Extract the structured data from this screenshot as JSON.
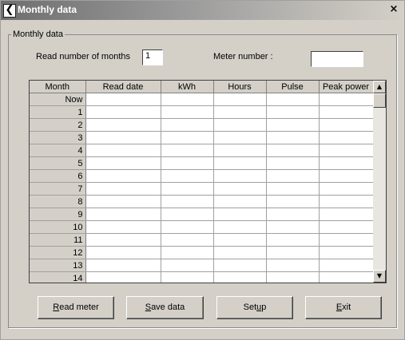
{
  "window": {
    "title": "Monthly data",
    "close_glyph": "×",
    "app_icon_glyph": "❮"
  },
  "group": {
    "legend": "Monthly data"
  },
  "fields": {
    "months_label": "Read number of months",
    "months_value": "1",
    "meter_label": "Meter number :",
    "meter_value": ""
  },
  "table": {
    "columns": [
      "Month",
      "Read date",
      "kWh",
      "Hours",
      "Pulse",
      "Peak power"
    ],
    "rows": [
      "Now",
      "1",
      "2",
      "3",
      "4",
      "5",
      "6",
      "7",
      "8",
      "9",
      "10",
      "11",
      "12",
      "13",
      "14"
    ]
  },
  "scrollbar": {
    "up_glyph": "▲",
    "down_glyph": "▼"
  },
  "buttons": [
    {
      "key": "R",
      "rest": "ead meter",
      "prefix": ""
    },
    {
      "key": "S",
      "rest": "ave data",
      "prefix": ""
    },
    {
      "key": "u",
      "rest": "p",
      "prefix": "Set"
    },
    {
      "key": "E",
      "rest": "xit",
      "prefix": ""
    }
  ]
}
